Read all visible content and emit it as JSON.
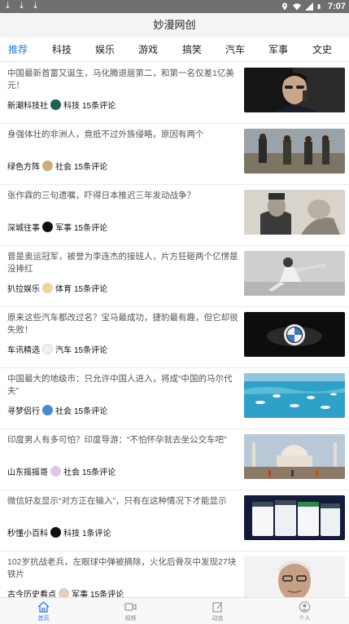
{
  "status_bar": {
    "time": "7:07",
    "icons": [
      "download-icon",
      "download-icon",
      "location-icon",
      "wifi-icon",
      "signal-icon",
      "battery-icon"
    ]
  },
  "app": {
    "title": "妙漫网创"
  },
  "colors": {
    "accent": "#2e7bd6",
    "status_bar": "#6f6f6f",
    "title_bar": "#f4f4f4"
  },
  "tabs": [
    {
      "label": "推荐",
      "active": true
    },
    {
      "label": "科技"
    },
    {
      "label": "娱乐"
    },
    {
      "label": "游戏"
    },
    {
      "label": "搞笑"
    },
    {
      "label": "汽车"
    },
    {
      "label": "军事"
    },
    {
      "label": "文史"
    }
  ],
  "news": [
    {
      "headline": "中国最新首富又诞生，马化腾退居第二，和第一名仅差1亿美元！",
      "source": "新潮科技社",
      "category": "科技",
      "comments": "15条评论"
    },
    {
      "headline": "身强体壮的非洲人，竟抵不过外族侵略，原因有两个",
      "source": "绿色方阵",
      "category": "社会",
      "comments": "15条评论"
    },
    {
      "headline": "张作霖的三句遗嘱，吓得日本推迟三年发动战争？",
      "source": "深城往事",
      "category": "军事",
      "comments": "15条评论"
    },
    {
      "headline": "曾是奥运冠军，被誉为李连杰的接班人，片方狂砸两个亿愣是没捧红",
      "source": "扒拉娱乐",
      "category": "体育",
      "comments": "15条评论"
    },
    {
      "headline": "原来这些汽车都改过名？宝马最成功，捷豹最有趣，但它却很失败！",
      "source": "车讯精选",
      "category": "汽车",
      "comments": "15条评论"
    },
    {
      "headline": "中国最大的地级市：只允许中国人进入，将成“中国的马尔代夫”",
      "source": "寻梦侣行",
      "category": "社会",
      "comments": "15条评论"
    },
    {
      "headline": "印度男人有多可怕？印度导游：“不怕怀孕就去坐公交车吧”",
      "source": "山东摇摇哥",
      "category": "社会",
      "comments": "15条评论"
    },
    {
      "headline": "微信好友显示“对方正在输入”，只有在这种情况下才能显示",
      "source": "秒懂小百科",
      "category": "科技",
      "comments": "1条评论"
    },
    {
      "headline": "102岁抗战老兵，左眼球中弹被摘除，火化后骨灰中发现27块铁片",
      "source": "古今历史看点",
      "category": "军事",
      "comments": "15条评论"
    }
  ],
  "bottom_nav": [
    {
      "label": "首页",
      "icon": "home-icon",
      "active": true
    },
    {
      "label": "视频",
      "icon": "video-icon"
    },
    {
      "label": "动态",
      "icon": "edit-icon"
    },
    {
      "label": "个人",
      "icon": "user-icon"
    }
  ]
}
